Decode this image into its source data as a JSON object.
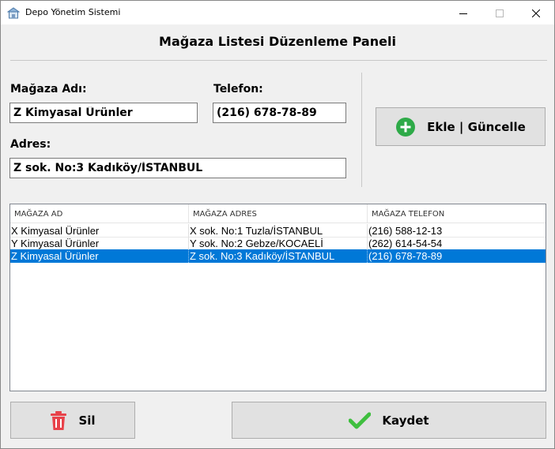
{
  "window": {
    "title": "Depo Yönetim Sistemi",
    "icon": "warehouse-icon",
    "buttons": [
      "minimize-icon",
      "maximize-icon",
      "close-icon"
    ]
  },
  "panel": {
    "title": "Mağaza Listesi Düzenleme Paneli"
  },
  "form": {
    "name_label": "Mağaza Adı:",
    "name_value": "Z Kimyasal Ürünler",
    "phone_label": "Telefon:",
    "phone_value": "(216) 678-78-89",
    "address_label": "Adres:",
    "address_value": "Z sok. No:3 Kadıköy/İSTANBUL"
  },
  "buttons": {
    "add_update": {
      "label": "Ekle | Güncelle",
      "icon": "plus-circle-icon",
      "color": "#2eaa48"
    },
    "delete": {
      "label": "Sil",
      "icon": "trash-icon",
      "color": "#e8424a"
    },
    "save": {
      "label": "Kaydet",
      "icon": "checkmark-icon",
      "color": "#3fbf3f"
    }
  },
  "table": {
    "columns": [
      "MAĞAZA AD",
      "MAĞAZA ADRES",
      "MAĞAZA TELEFON"
    ],
    "rows": [
      [
        "X Kimyasal Ürünler",
        "X sok. No:1 Tuzla/İSTANBUL",
        "(216) 588-12-13"
      ],
      [
        "Y Kimyasal Ürünler",
        "Y sok. No:2 Gebze/KOCAELİ",
        "(262) 614-54-54"
      ],
      [
        "Z Kimyasal Ürünler",
        "Z sok. No:3 Kadıköy/İSTANBUL",
        "(216) 678-78-89"
      ]
    ],
    "selected_row": 3,
    "selection_color": "#0078d7"
  }
}
